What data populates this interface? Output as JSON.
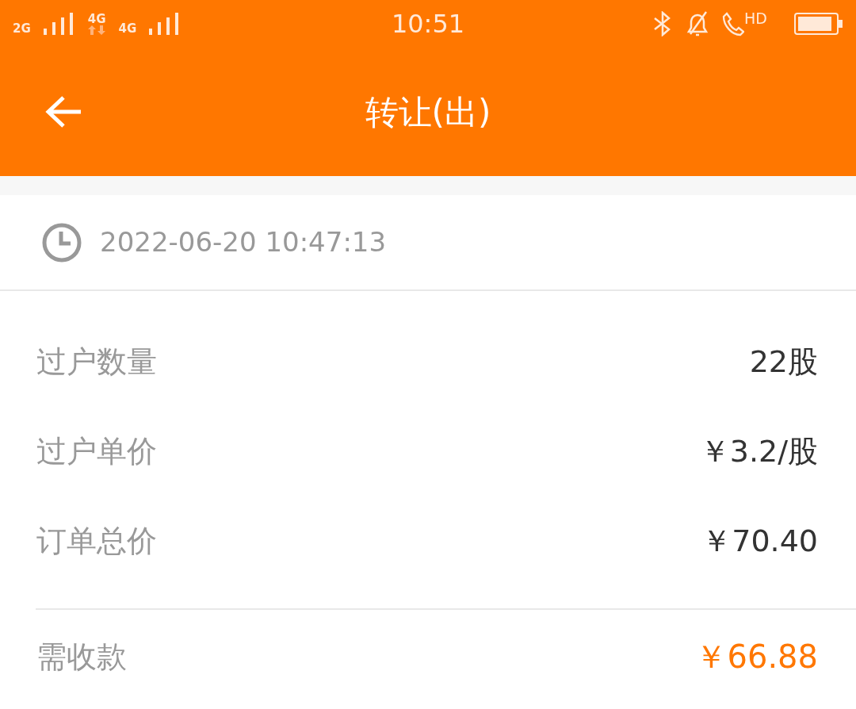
{
  "status_bar": {
    "networks": [
      {
        "label": "2G",
        "kind": "plain"
      },
      {
        "label": "4G",
        "kind": "data"
      },
      {
        "label": "4G",
        "kind": "plain"
      }
    ],
    "time": "10:51",
    "call_label": "HD"
  },
  "header": {
    "title": "转让(出)"
  },
  "order_time": "2022-06-20 10:47:13",
  "details": [
    {
      "label": "过户数量",
      "value": "22股"
    },
    {
      "label": "过户单价",
      "value": "￥3.2/股"
    },
    {
      "label": "订单总价",
      "value": "￥70.40"
    }
  ],
  "receivable": {
    "label": "需收款",
    "value": "￥66.88"
  }
}
